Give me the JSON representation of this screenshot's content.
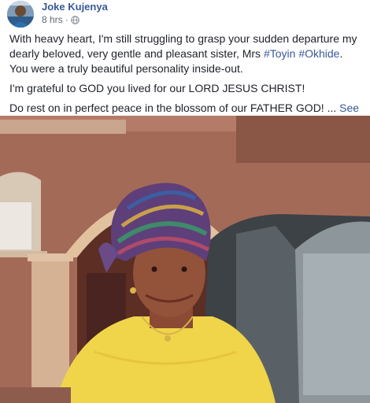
{
  "post": {
    "author": "Joke Kujenya",
    "timestamp": "8 hrs",
    "separator": "·",
    "privacy_icon": "globe-icon",
    "paragraphs": [
      {
        "text_before": "With heavy heart, I'm still struggling to grasp your sudden departure my dearly beloved, very gentle and pleasant sister, Mrs ",
        "hashtag_1": "#Toyin",
        "space": " ",
        "hashtag_2": "#Okhide",
        "text_after": ". You were a truly beautiful personality inside-out."
      },
      {
        "text": "I'm grateful to GOD you lived for our LORD JESUS CHRIST!"
      },
      {
        "text": "Do rest on in perfect peace in the blossom of our FATHER GOD! ...",
        "see_more": "See More"
      }
    ]
  },
  "colors": {
    "link": "#385898",
    "text": "#1d2129",
    "meta": "#616770"
  }
}
